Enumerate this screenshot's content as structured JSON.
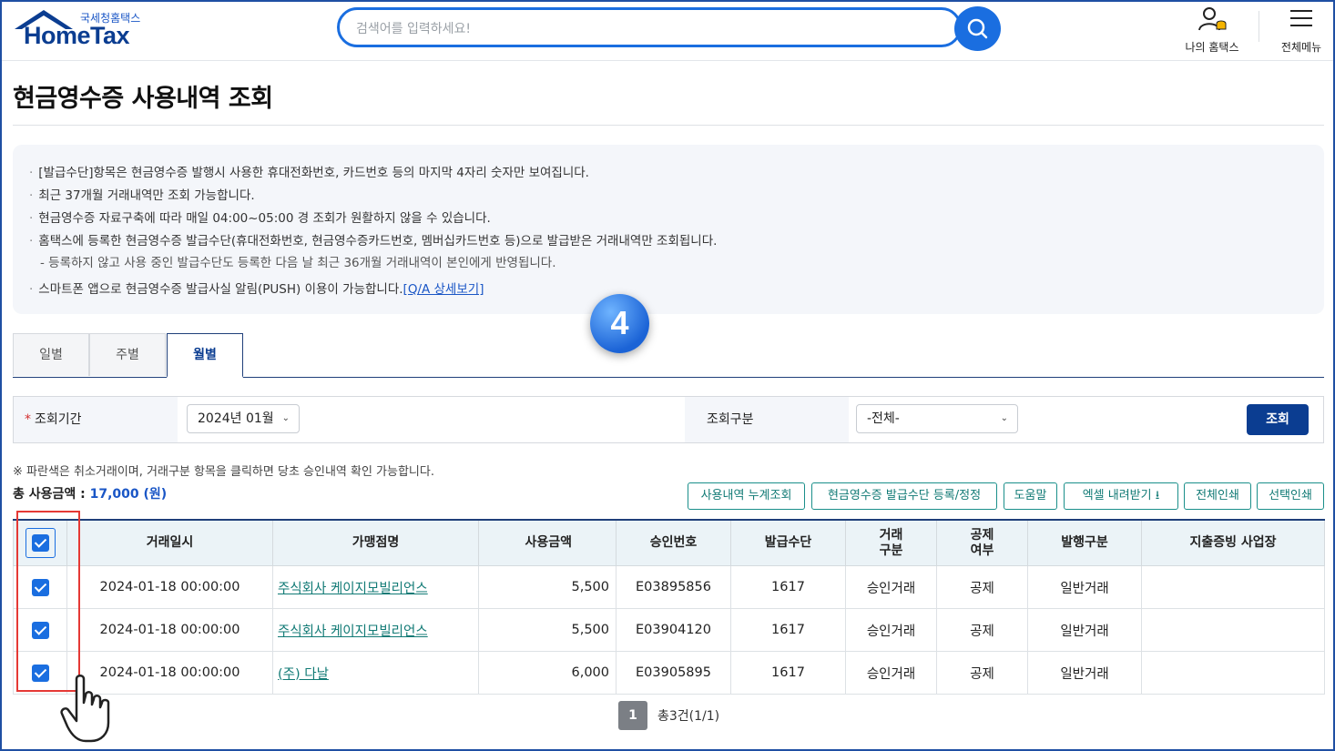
{
  "header": {
    "logo_small": "국세청홈택스",
    "logo_big": "HomeTax",
    "search_placeholder": "검색어를 입력하세요!",
    "my_hometax": "나의 홈택스",
    "all_menu": "전체메뉴"
  },
  "page_title": "현금영수증 사용내역 조회",
  "notices": [
    "[발급수단]항목은 현금영수증 발행시 사용한 휴대전화번호, 카드번호 등의 마지막 4자리 숫자만 보여집니다.",
    "최근 37개월 거래내역만 조회 가능합니다.",
    "현금영수증 자료구축에 따라 매일 04:00~05:00 경 조회가 원활하지 않을 수 있습니다.",
    "홈택스에 등록한 현금영수증 발급수단(휴대전화번호, 현금영수증카드번호, 멤버십카드번호 등)으로 발급받은 거래내역만 조회됩니다.",
    "- 등록하지 않고 사용 중인 발급수단도 등록한 다음 날 최근 36개월 거래내역이 본인에게 반영됩니다.",
    "스마트폰 앱으로 현금영수증 발급사실 알림(PUSH) 이용이 가능합니다."
  ],
  "notice_link": "[Q/A 상세보기]",
  "step_badge": "4",
  "tabs": [
    "일별",
    "주별",
    "월별"
  ],
  "search": {
    "period_label": "조회기간",
    "period_value": "2024년 01월",
    "type_label": "조회구분",
    "type_value": "-전체-",
    "query_button": "조회"
  },
  "note": "※ 파란색은 취소거래이며, 거래구분 항목을 클릭하면 당초 승인내역 확인 가능합니다.",
  "total_label": "총 사용금액 :",
  "total_amount": "17,000 (원)",
  "action_buttons": [
    "사용내역 누계조회",
    "현금영수증 발급수단 등록/정정",
    "도움말",
    "엑셀 내려받기",
    "전체인쇄",
    "선택인쇄"
  ],
  "table": {
    "columns": [
      "거래일시",
      "가맹점명",
      "사용금액",
      "승인번호",
      "발급수단",
      "거래\n구분",
      "공제\n여부",
      "발행구분",
      "지출증빙 사업장"
    ],
    "rows": [
      [
        "2024-01-18 00:00:00",
        "주식회사 케이지모빌리언스",
        "5,500",
        "E03895856",
        "1617",
        "승인거래",
        "공제",
        "일반거래",
        ""
      ],
      [
        "2024-01-18 00:00:00",
        "주식회사 케이지모빌리언스",
        "5,500",
        "E03904120",
        "1617",
        "승인거래",
        "공제",
        "일반거래",
        ""
      ],
      [
        "2024-01-18 00:00:00",
        "(주) 다날",
        "6,000",
        "E03905895",
        "1617",
        "승인거래",
        "공제",
        "일반거래",
        ""
      ]
    ]
  },
  "pager": {
    "current": "1",
    "summary": "총3건(1/1)"
  },
  "colors": {
    "primary": "#1a6ee0",
    "navy": "#0b3d91",
    "teal": "#117a75",
    "highlight": "#e53935"
  }
}
